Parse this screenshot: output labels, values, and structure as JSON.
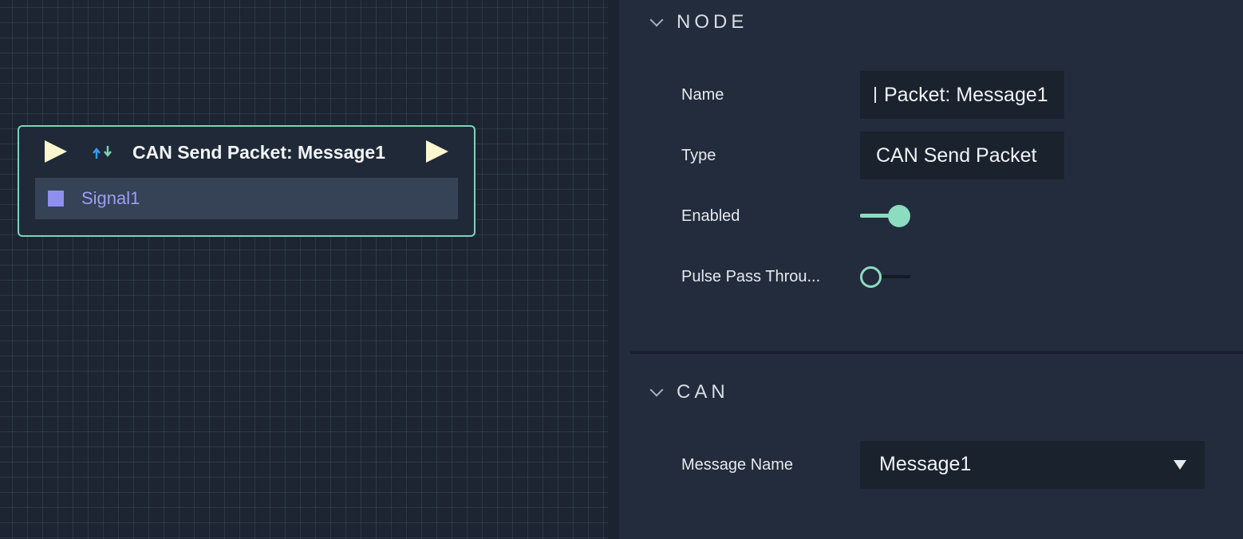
{
  "graph": {
    "node": {
      "title": "CAN Send Packet: Message1",
      "icon": "can-send-arrows-icon",
      "signal_label": "Signal1"
    }
  },
  "panel": {
    "node_section": {
      "title": "NODE",
      "name_label": "Name",
      "name_value": "Packet: Message1",
      "type_label": "Type",
      "type_value": "CAN Send Packet",
      "enabled_label": "Enabled",
      "enabled": true,
      "pulse_label": "Pulse Pass Throu...",
      "pulse_pass_through": false
    },
    "can_section": {
      "title": "CAN",
      "message_name_label": "Message Name",
      "message_name_value": "Message1"
    }
  },
  "colors": {
    "accent": "#8ddcc0",
    "pulse": "#fbf6cd",
    "signal": "#8f8ff0"
  }
}
